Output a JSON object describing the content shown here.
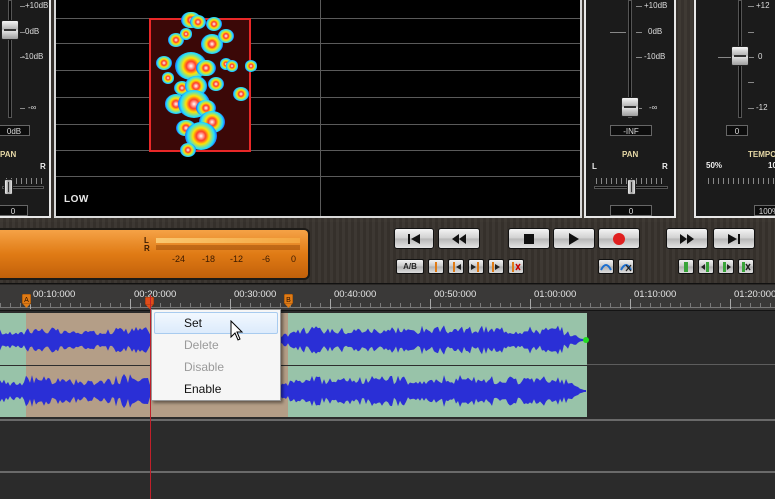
{
  "left_strip": {
    "db_plus10": "+10dB",
    "db_0": "0dB",
    "db_minus10": "-10dB",
    "db_inf": "-∞",
    "fader_value": "0dB",
    "pan_label": "PAN",
    "right_label": "R",
    "pan_value": "0"
  },
  "spectrum": {
    "band_label": "LOW"
  },
  "right_strip": {
    "db_plus10": "+10dB",
    "db_0": "0dB",
    "db_minus10": "-10dB",
    "db_inf": "-∞",
    "fader_value": "-INF",
    "pan_label": "PAN",
    "left_label": "L",
    "right_label": "R",
    "pan_value": "0"
  },
  "tempo_strip": {
    "pitch_plus12": "+12",
    "pitch_0": "0",
    "pitch_minus12": "-12",
    "fader_value": "0",
    "tempo_label": "TEMPO",
    "min_label": "50%",
    "max_label": "10",
    "tempo_value": "100%"
  },
  "level_meter": {
    "left_channel": "L",
    "right_channel": "R",
    "ticks": [
      "-24",
      "-18",
      "-12",
      "-6",
      "0"
    ]
  },
  "transport": {
    "ab_label": "A/B"
  },
  "timeline": {
    "labels": [
      "00:10:000",
      "00:20:000",
      "00:30:000",
      "00:40:000",
      "00:50:000",
      "01:00:000",
      "01:10:000",
      "01:20:000"
    ],
    "marker_a": "A",
    "marker_b": "B"
  },
  "context_menu": {
    "items": [
      {
        "label": "Set",
        "enabled": true,
        "hover": true
      },
      {
        "label": "Delete",
        "enabled": false
      },
      {
        "label": "Disable",
        "enabled": false
      },
      {
        "label": "Enable",
        "enabled": true
      }
    ]
  },
  "colors": {
    "waveform": "#2a2fd6",
    "clip_region": "#98c3a9",
    "loop_region": "#b49e87",
    "playhead": "#c0202a",
    "meter": "#e07b15",
    "record": "#e02020"
  }
}
